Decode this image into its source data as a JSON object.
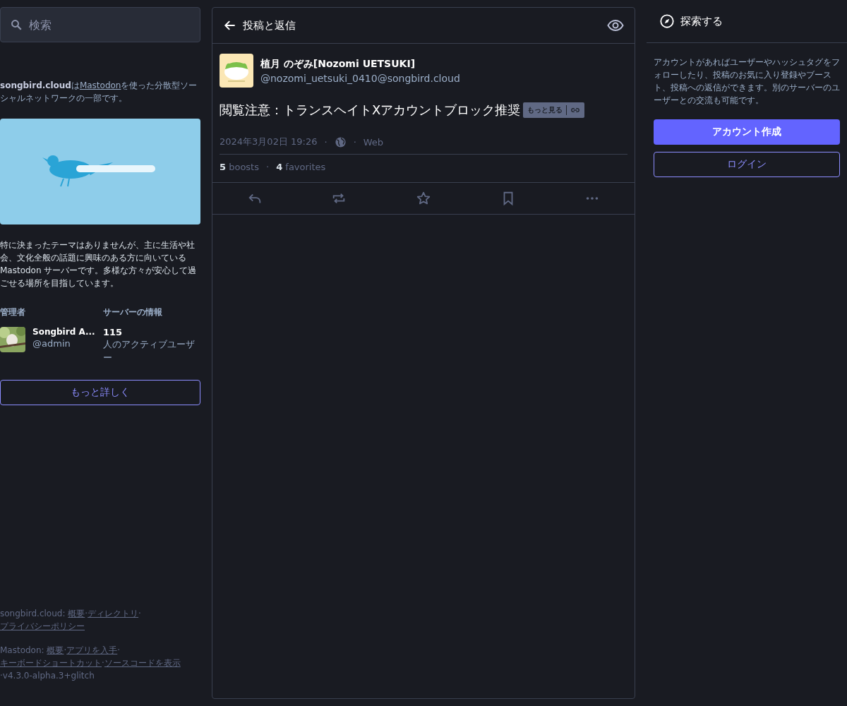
{
  "search": {
    "placeholder": "検索"
  },
  "about": {
    "server": "songbird.cloud",
    "joiner": "は",
    "link": "Mastodon",
    "rest": "を使った分散型ソーシャルネットワークの一部です。"
  },
  "description": "特に決まったテーマはありませんが、主に生活や社会、文化全般の話題に興味のある方に向いている Mastodon サーバーです。多様な方々が安心して過ごせる場所を目指しています。",
  "admin": {
    "heading": "管理者",
    "name": "Songbird A...",
    "handle": "@admin"
  },
  "server_info": {
    "heading": "サーバーの情報",
    "count": "115",
    "label": "人のアクティブユーザー"
  },
  "more_button": "もっと詳しく",
  "footer": [
    {
      "label": "songbird.cloud:",
      "separator": "·",
      "links": [
        "概要",
        "ディレクトリ",
        "プライバシーポリシー"
      ]
    },
    {
      "label": "Mastodon:",
      "separator": "·",
      "links": [
        "概要",
        "アプリを入手",
        "キーボードショートカット",
        "ソースコードを表示"
      ],
      "version": "v4.3.0-alpha.3+glitch"
    }
  ],
  "column": {
    "title": "投稿と返信"
  },
  "post": {
    "display_name": "植月 のぞみ[Nozomi UETSUKI]",
    "handle": "@nozomi_uetsuki_0410@songbird.cloud",
    "spoiler": "閲覧注意：トランスヘイトXアカウントブロック推奨",
    "show_more": "もっと見る",
    "timestamp": "2024年3月02日 19:26",
    "via": "Web",
    "separator": "·",
    "boosts": "5",
    "boosts_label": "boosts",
    "favorites": "4",
    "favorites_label": "favorites"
  },
  "actions": [
    {
      "kind": "reply"
    },
    {
      "kind": "boost"
    },
    {
      "kind": "favorite"
    },
    {
      "kind": "bookmark"
    },
    {
      "kind": "more"
    }
  ],
  "explore": {
    "title": "探索する",
    "text": "アカウントがあればユーザーやハッシュタグをフォローしたり、投稿のお気に入り登録やブースト、投稿への返信ができます。別のサーバーのユーザーとの交流も可能です。",
    "signup": "アカウント作成",
    "login": "ログイン"
  }
}
